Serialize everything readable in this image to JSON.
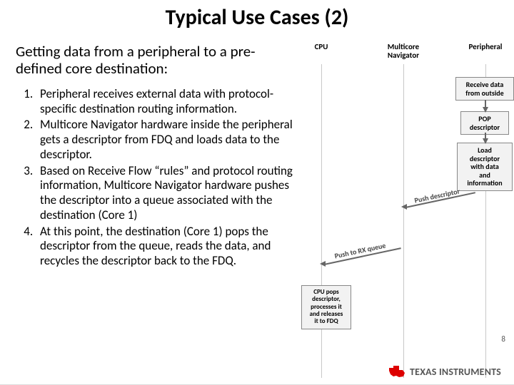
{
  "title": "Typical Use Cases (2)",
  "subtitle": "Getting data from a peripheral to a pre-defined core destination:",
  "list": {
    "items": [
      "Peripheral receives external data with protocol-specific destination routing information.",
      "Multicore Navigator hardware inside the peripheral gets a descriptor from FDQ and loads data to the descriptor.",
      "Based on Receive Flow “rules” and protocol routing information, Multicore Navigator hardware pushes the descriptor into a queue associated with the destination (Core 1)",
      "At this point, the destination (Core 1) pops the descriptor from the queue, reads the data, and recycles the descriptor back to the FDQ."
    ]
  },
  "diagram": {
    "lanes": {
      "cpu": "CPU",
      "nav": "Multicore\nNavigator",
      "periph": "Peripheral"
    },
    "boxes": {
      "recv": "Receive data\nfrom outside",
      "pop": "POP\ndescriptor",
      "load": "Load\ndescriptor\nwith data\nand\ninformation",
      "cpu_pop": "CPU pops\ndescriptor,\nprocesses it\nand releases\nit to FDQ"
    },
    "arrows": {
      "push_desc": "Push descriptor",
      "push_rx": "Push to RX queue"
    }
  },
  "page_number": "8",
  "logo_text": "TEXAS INSTRUMENTS"
}
